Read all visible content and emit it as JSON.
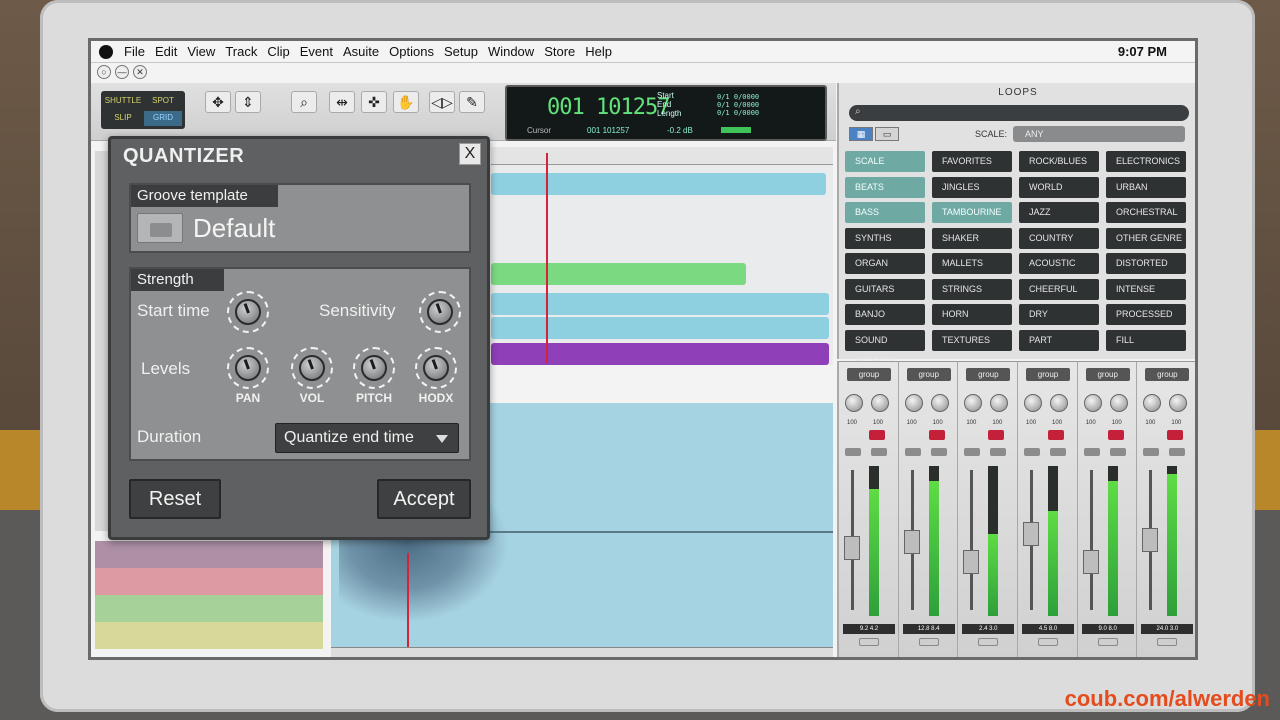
{
  "menubar": {
    "items": [
      "File",
      "Edit",
      "View",
      "Track",
      "Clip",
      "Event",
      "Asuite",
      "Options",
      "Setup",
      "Window",
      "Store",
      "Help"
    ],
    "clock": "9:07 PM"
  },
  "window_controls": [
    "○",
    "—",
    "✕"
  ],
  "toolbar": {
    "modes": [
      "SHUTTLE",
      "SPOT",
      "SLIP",
      "GRID"
    ]
  },
  "transport": {
    "timecode": "001 101257",
    "labels": [
      "Start",
      "End",
      "Length"
    ],
    "values": [
      "0/1 0/0000",
      "0/1 0/0000",
      "0/1 0/0000"
    ],
    "cursor_label": "Cursor",
    "cursor_value": "001 101257",
    "db": "-0.2 dB"
  },
  "quantizer": {
    "title": "QUANTIZER",
    "close": "X",
    "groove_header": "Groove template",
    "groove_name": "Default",
    "strength_header": "Strength",
    "start_time": "Start time",
    "sensitivity": "Sensitivity",
    "levels": "Levels",
    "knobs": [
      "PAN",
      "VOL",
      "PITCH",
      "HODX"
    ],
    "duration": "Duration",
    "duration_value": "Quantize end time",
    "reset": "Reset",
    "accept": "Accept"
  },
  "loops": {
    "title": "LOOPS",
    "search_icon": "search-icon",
    "scale_label": "SCALE:",
    "scale_value": "ANY",
    "buttons": [
      [
        "SCALE",
        "FAVORITES",
        "ROCK/BLUES",
        "ELECTRONICS"
      ],
      [
        "BEATS",
        "JINGLES",
        "WORLD",
        "URBAN"
      ],
      [
        "BASS",
        "TAMBOURINE",
        "JAZZ",
        "ORCHESTRAL"
      ],
      [
        "SYNTHS",
        "SHAKER",
        "COUNTRY",
        "OTHER GENRE"
      ],
      [
        "ORGAN",
        "MALLETS",
        "ACOUSTIC",
        "DISTORTED"
      ],
      [
        "GUITARS",
        "STRINGS",
        "CHEERFUL",
        "INTENSE"
      ],
      [
        "BANJO",
        "HORN",
        "DRY",
        "PROCESSED"
      ],
      [
        "SOUND EFFECTS",
        "TEXTURES",
        "PART",
        "FILL"
      ]
    ],
    "active": [
      "SCALE",
      "BEATS",
      "BASS",
      "TAMBOURINE"
    ]
  },
  "mixer": {
    "strips": [
      {
        "group": "group",
        "vals": [
          "100",
          "100"
        ],
        "level": "9.2   4.2",
        "meter": 0.85
      },
      {
        "group": "group",
        "vals": [
          "100",
          "100"
        ],
        "level": "12.8   8.4",
        "meter": 0.9
      },
      {
        "group": "group",
        "vals": [
          "100",
          "100"
        ],
        "level": "2.4   3.0",
        "meter": 0.55
      },
      {
        "group": "group",
        "vals": [
          "100",
          "100"
        ],
        "level": "4.5   8.0",
        "meter": 0.7
      },
      {
        "group": "group",
        "vals": [
          "100",
          "100"
        ],
        "level": "9.0   8.0",
        "meter": 0.9
      },
      {
        "group": "group",
        "vals": [
          "100",
          "100"
        ],
        "level": "24.0   3.0",
        "meter": 0.95
      }
    ]
  },
  "watermark": "coub.com/alwerden",
  "colors": {
    "clip_blue": "#8fd0e0",
    "clip_green": "#7bd982",
    "clip_purple": "#8f3fb8",
    "playhead": "#d4233b",
    "loop_active": "#6fa9a3"
  }
}
